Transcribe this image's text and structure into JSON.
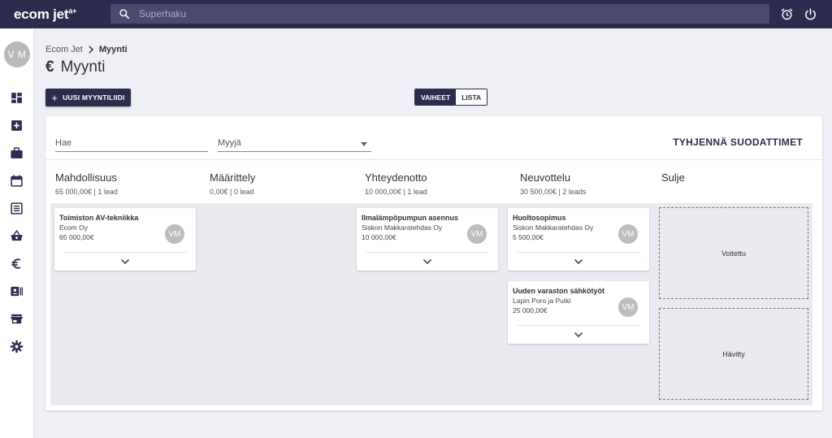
{
  "app": {
    "logo_text": "ecom jet",
    "logo_sup": "a+"
  },
  "search": {
    "placeholder": "Superhaku"
  },
  "topbar_icons": [
    "alarm-clock-icon",
    "power-icon"
  ],
  "sidebar": {
    "avatar_initials": "V M",
    "items": [
      "dashboard-icon",
      "add-box-icon",
      "briefcase-icon",
      "calendar-icon",
      "list-icon",
      "basket-icon",
      "euro-icon",
      "contacts-icon",
      "store-icon",
      "settings-icon"
    ]
  },
  "breadcrumb": {
    "root": "Ecom Jet",
    "current": "Myynti"
  },
  "page": {
    "icon": "€",
    "title": "Myynti"
  },
  "actions": {
    "new_lead": "UUSI MYYNTILIIDI",
    "view_stages": "VAIHEET",
    "view_list": "LISTA"
  },
  "filters": {
    "search_label": "Hae",
    "seller_label": "Myyjä",
    "clear": "TYHJENNÄ SUODATTIMET"
  },
  "columns": [
    {
      "name": "Mahdollisuus",
      "meta": "65 000,00€ | 1 lead"
    },
    {
      "name": "Määrittely",
      "meta": "0,00€ | 0 lead"
    },
    {
      "name": "Yhteydenotto",
      "meta": "10 000,00€ | 1 lead"
    },
    {
      "name": "Neuvottelu",
      "meta": "30 500,00€ | 2 leads"
    },
    {
      "name": "Sulje",
      "meta": ""
    }
  ],
  "cards": [
    {
      "title": "Toimiston AV-tekniikka",
      "company": "Ecom Oy",
      "amount": "65 000,00€",
      "owner": "VM"
    },
    {
      "title": "Ilmalämpöpumpun asennus",
      "company": "Siskon Makkaratehdas Oy",
      "amount": "10 000,00€",
      "owner": "VM"
    },
    {
      "title": "Huoltosopimus",
      "company": "Siskon Makkaratehdas Oy",
      "amount": "5 500,00€",
      "owner": "VM"
    },
    {
      "title": "Uuden varaston sähkötyöt",
      "company": "Lapin Poro ja Putki",
      "amount": "25 000,00€",
      "owner": "VM"
    }
  ],
  "close_zones": {
    "won": "Voitettu",
    "lost": "Hävitty"
  }
}
